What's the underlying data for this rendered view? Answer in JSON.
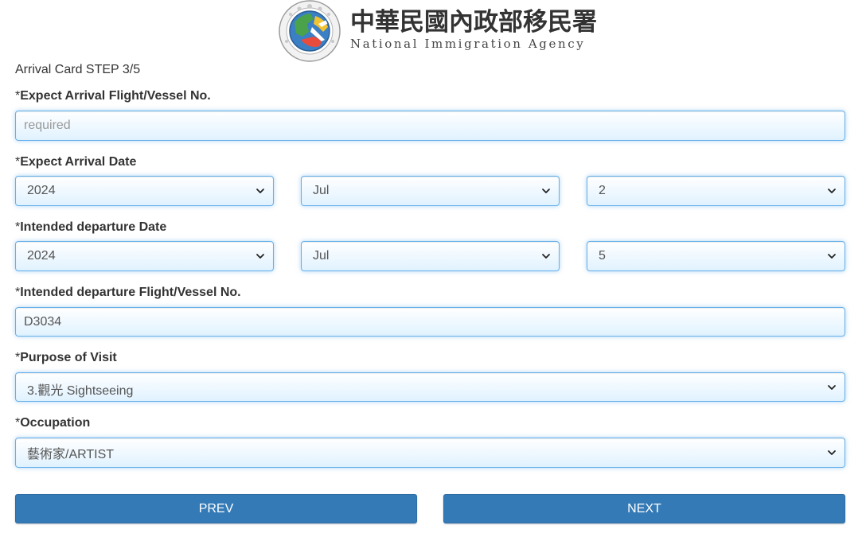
{
  "header": {
    "org_name_cn": "中華民國內政部移民署",
    "org_name_en": "National Immigration Agency"
  },
  "step_title": "Arrival Card STEP 3/5",
  "form": {
    "arrival_flight": {
      "required_mark": "*",
      "label": "Expect Arrival Flight/Vessel No.",
      "value": "",
      "placeholder": "required"
    },
    "arrival_date": {
      "required_mark": "*",
      "label": "Expect Arrival Date",
      "year": "2024",
      "month": "Jul",
      "day": "2"
    },
    "departure_date": {
      "required_mark": "*",
      "label": "Intended departure Date",
      "year": "2024",
      "month": "Jul",
      "day": "5"
    },
    "departure_flight": {
      "required_mark": "*",
      "label": "Intended departure Flight/Vessel No.",
      "value": "D3034"
    },
    "purpose": {
      "required_mark": "*",
      "label": "Purpose of Visit",
      "value": "3.觀光 Sightseeing"
    },
    "occupation": {
      "required_mark": "*",
      "label": "Occupation",
      "value": "藝術家/ARTIST"
    }
  },
  "buttons": {
    "prev": "PREV",
    "next": "NEXT"
  },
  "icons": {
    "select_arrow": "chevron-down-icon",
    "logo": "national-immigration-agency-emblem"
  },
  "colors": {
    "button_bg": "#337ab7",
    "field_border": "#66afe9",
    "field_gradient_end": "#e0f2ff",
    "text": "#333333"
  }
}
